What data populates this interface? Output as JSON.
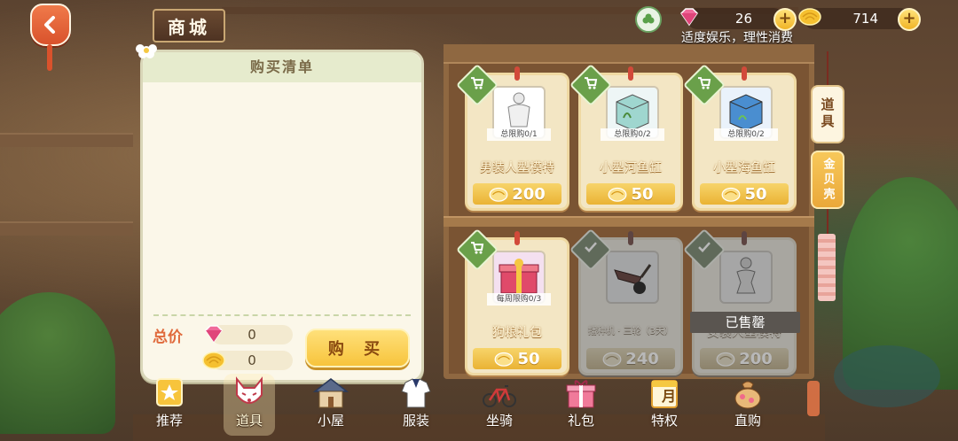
{
  "header": {
    "title": "商城",
    "notice": "适度娱乐，理性消费"
  },
  "currency": {
    "gems": "26",
    "gold": "714"
  },
  "purchase_list": {
    "title": "购买清单",
    "total_label": "总价",
    "gem_total": "0",
    "gold_total": "0",
    "buy_label": "购 买"
  },
  "items": [
    {
      "name": "男装人型模特",
      "limit": "总限购0/1",
      "price": "200",
      "state": "available"
    },
    {
      "name": "小型河鱼缸",
      "limit": "总限购0/2",
      "price": "50",
      "state": "available"
    },
    {
      "name": "小型海鱼缸",
      "limit": "总限购0/2",
      "price": "50",
      "state": "available"
    },
    {
      "name": "狗粮礼包",
      "limit": "每周限购0/3",
      "price": "50",
      "state": "available"
    },
    {
      "name": "播种机 · 三轮（3天）",
      "limit": "",
      "price": "240",
      "state": "owned"
    },
    {
      "name": "女装人型模特",
      "limit": "",
      "price": "200",
      "state": "sold",
      "sold_label": "已售罄"
    }
  ],
  "side_tabs": [
    {
      "label": "道具",
      "active": true
    },
    {
      "label": "金贝壳",
      "active": false
    }
  ],
  "nav": [
    {
      "label": "推荐",
      "icon": "star-icon"
    },
    {
      "label": "道具",
      "icon": "fox-mask-icon",
      "active": true
    },
    {
      "label": "小屋",
      "icon": "house-icon"
    },
    {
      "label": "服装",
      "icon": "sailor-shirt-icon"
    },
    {
      "label": "坐骑",
      "icon": "bicycle-icon"
    },
    {
      "label": "礼包",
      "icon": "gift-box-icon"
    },
    {
      "label": "特权",
      "icon": "calendar-month-icon",
      "badge": "月"
    },
    {
      "label": "直购",
      "icon": "money-bag-icon"
    }
  ],
  "colors": {
    "accent_gold": "#f7c43c",
    "tab_green": "#6aa04a",
    "panel_bg": "#fbf7e9",
    "total_label": "#e06a3c"
  }
}
